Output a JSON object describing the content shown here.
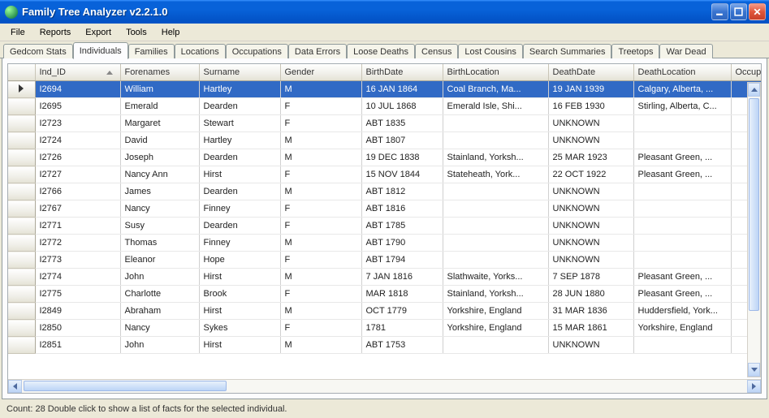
{
  "window": {
    "title": "Family Tree Analyzer v2.2.1.0"
  },
  "menu": {
    "items": [
      "File",
      "Reports",
      "Export",
      "Tools",
      "Help"
    ]
  },
  "tabs": [
    "Gedcom Stats",
    "Individuals",
    "Families",
    "Locations",
    "Occupations",
    "Data Errors",
    "Loose Deaths",
    "Census",
    "Lost Cousins",
    "Search Summaries",
    "Treetops",
    "War Dead"
  ],
  "active_tab": 1,
  "grid": {
    "columns": [
      "Ind_ID",
      "Forenames",
      "Surname",
      "Gender",
      "BirthDate",
      "BirthLocation",
      "DeathDate",
      "DeathLocation",
      "Occupation"
    ],
    "sort_col": 0,
    "sort_dir": "asc",
    "rows": [
      {
        "sel": true,
        "id": "I2694",
        "fore": "William",
        "sur": "Hartley",
        "g": "M",
        "bd": "16 JAN 1864",
        "bl": "Coal Branch, Ma...",
        "dd": "19 JAN 1939",
        "dl": "Calgary, Alberta, ...",
        "occ": ""
      },
      {
        "id": "I2695",
        "fore": "Emerald",
        "sur": "Dearden",
        "g": "F",
        "bd": "10 JUL 1868",
        "bl": "Emerald Isle, Shi...",
        "dd": "16 FEB 1930",
        "dl": "Stirling, Alberta, C...",
        "occ": ""
      },
      {
        "id": "I2723",
        "fore": "Margaret",
        "sur": "Stewart",
        "g": "F",
        "bd": "ABT 1835",
        "bl": "",
        "dd": "UNKNOWN",
        "dl": "",
        "occ": ""
      },
      {
        "id": "I2724",
        "fore": "David",
        "sur": "Hartley",
        "g": "M",
        "bd": "ABT 1807",
        "bl": "",
        "dd": "UNKNOWN",
        "dl": "",
        "occ": ""
      },
      {
        "id": "I2726",
        "fore": "Joseph",
        "sur": "Dearden",
        "g": "M",
        "bd": "19 DEC 1838",
        "bl": "Stainland, Yorksh...",
        "dd": "25 MAR 1923",
        "dl": "Pleasant Green, ...",
        "occ": ""
      },
      {
        "id": "I2727",
        "fore": "Nancy Ann",
        "sur": "Hirst",
        "g": "F",
        "bd": "15 NOV 1844",
        "bl": "Stateheath, York...",
        "dd": "22 OCT 1922",
        "dl": "Pleasant Green, ...",
        "occ": ""
      },
      {
        "id": "I2766",
        "fore": "James",
        "sur": "Dearden",
        "g": "M",
        "bd": "ABT 1812",
        "bl": "",
        "dd": "UNKNOWN",
        "dl": "",
        "occ": ""
      },
      {
        "id": "I2767",
        "fore": "Nancy",
        "sur": "Finney",
        "g": "F",
        "bd": "ABT 1816",
        "bl": "",
        "dd": "UNKNOWN",
        "dl": "",
        "occ": ""
      },
      {
        "id": "I2771",
        "fore": "Susy",
        "sur": "Dearden",
        "g": "F",
        "bd": "ABT 1785",
        "bl": "",
        "dd": "UNKNOWN",
        "dl": "",
        "occ": ""
      },
      {
        "id": "I2772",
        "fore": "Thomas",
        "sur": "Finney",
        "g": "M",
        "bd": "ABT 1790",
        "bl": "",
        "dd": "UNKNOWN",
        "dl": "",
        "occ": ""
      },
      {
        "id": "I2773",
        "fore": "Eleanor",
        "sur": "Hope",
        "g": "F",
        "bd": "ABT 1794",
        "bl": "",
        "dd": "UNKNOWN",
        "dl": "",
        "occ": ""
      },
      {
        "id": "I2774",
        "fore": "John",
        "sur": "Hirst",
        "g": "M",
        "bd": "7 JAN 1816",
        "bl": "Slathwaite, Yorks...",
        "dd": "7 SEP 1878",
        "dl": "Pleasant Green, ...",
        "occ": ""
      },
      {
        "id": "I2775",
        "fore": "Charlotte",
        "sur": "Brook",
        "g": "F",
        "bd": "MAR 1818",
        "bl": "Stainland, Yorksh...",
        "dd": "28 JUN 1880",
        "dl": "Pleasant Green, ...",
        "occ": ""
      },
      {
        "id": "I2849",
        "fore": "Abraham",
        "sur": "Hirst",
        "g": "M",
        "bd": "OCT 1779",
        "bl": "Yorkshire, England",
        "dd": "31 MAR 1836",
        "dl": "Huddersfield, York...",
        "occ": ""
      },
      {
        "id": "I2850",
        "fore": "Nancy",
        "sur": "Sykes",
        "g": "F",
        "bd": "1781",
        "bl": "Yorkshire, England",
        "dd": "15 MAR 1861",
        "dl": "Yorkshire, England",
        "occ": ""
      },
      {
        "id": "I2851",
        "fore": "John",
        "sur": "Hirst",
        "g": "M",
        "bd": "ABT 1753",
        "bl": "",
        "dd": "UNKNOWN",
        "dl": "",
        "occ": ""
      }
    ]
  },
  "status": {
    "text": "Count: 28   Double click to show a list of facts for the selected individual."
  }
}
